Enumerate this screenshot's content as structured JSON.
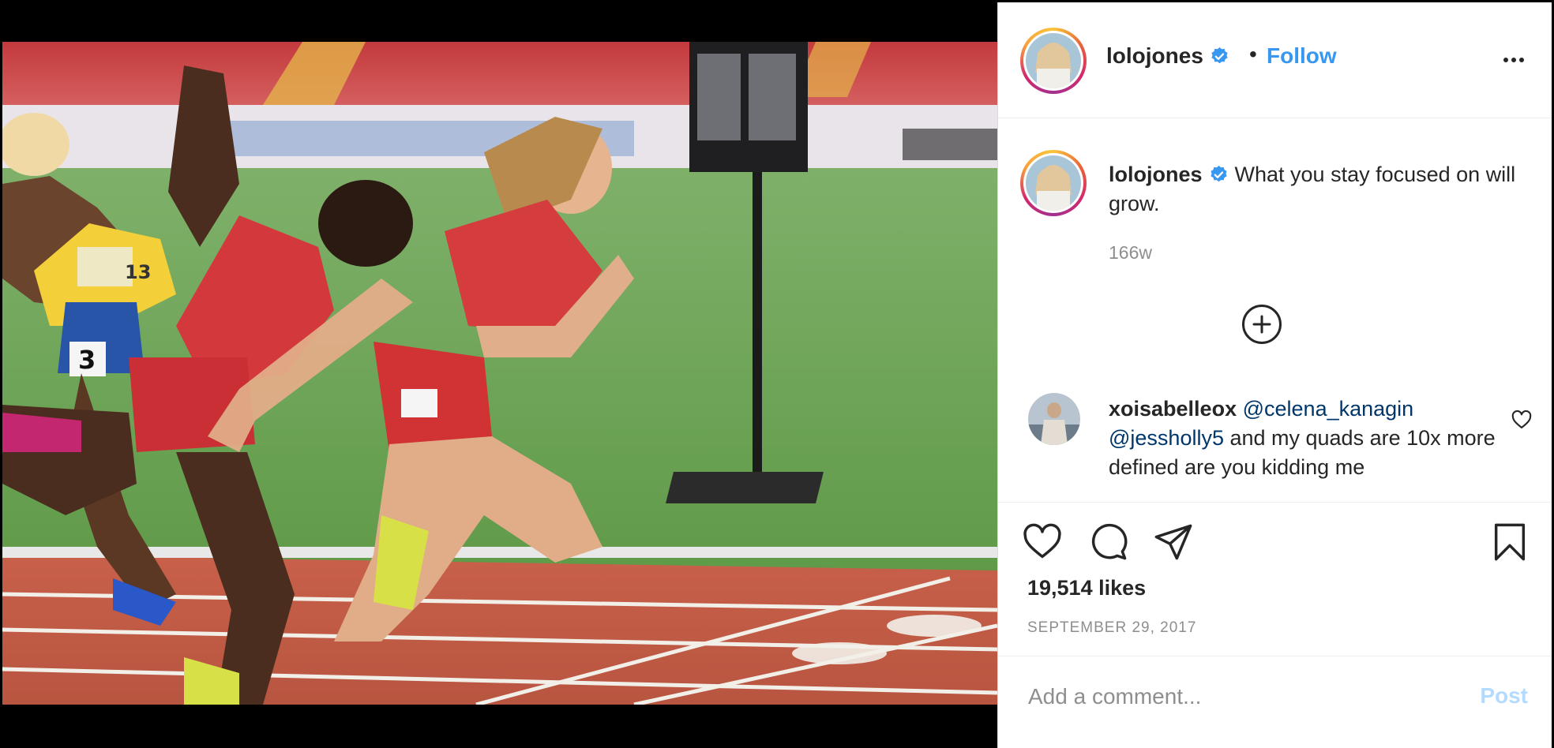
{
  "post": {
    "username": "lolojones",
    "follow_label": "Follow",
    "dot": "•",
    "caption": "What you stay focused on will grow.",
    "caption_time": "166w",
    "likes": "19,514 likes",
    "date": "SEPTEMBER 29, 2017"
  },
  "comment": {
    "username": "xoisabelleox",
    "mention1": "@celena_kanagin",
    "mention2": "@jessholly5",
    "text": " and my quads are 10x more defined are you kidding me"
  },
  "composer": {
    "placeholder": "Add a comment...",
    "post_label": "Post"
  },
  "photo": {
    "bib_1": "3",
    "bib_2": "13"
  },
  "colors": {
    "link_blue": "#3897f0",
    "mention_blue": "#00376b",
    "verified_blue": "#3897f0",
    "muted_gray": "#8e8e8e",
    "post_disabled": "#b3dbff"
  },
  "icons": [
    "verified-badge-icon",
    "more-options-icon",
    "load-more-comments-icon",
    "comment-like-heart-icon",
    "like-heart-icon",
    "comment-bubble-icon",
    "share-paper-plane-icon",
    "save-bookmark-icon"
  ]
}
